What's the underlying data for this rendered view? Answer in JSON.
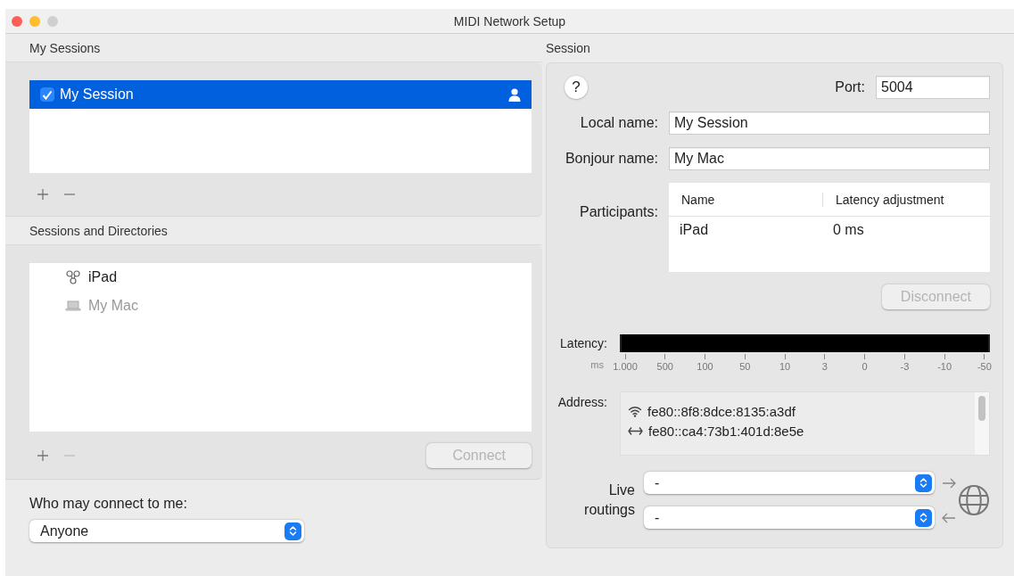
{
  "window": {
    "title": "MIDI Network Setup"
  },
  "my_sessions": {
    "heading": "My Sessions",
    "items": [
      {
        "label": "My Session",
        "checked": true,
        "selected": true
      }
    ],
    "remove_disabled": false
  },
  "directories": {
    "heading": "Sessions and Directories",
    "items": [
      {
        "label": "iPad",
        "kind": "device",
        "disabled": false
      },
      {
        "label": "My Mac",
        "kind": "computer",
        "disabled": true
      }
    ],
    "remove_disabled": true,
    "connect": {
      "label": "Connect",
      "disabled": true
    }
  },
  "access": {
    "label": "Who may connect to me:",
    "value": "Anyone"
  },
  "session": {
    "heading": "Session",
    "help": "?",
    "port_label": "Port:",
    "port": "5004",
    "local_name_label": "Local name:",
    "local_name": "My Session",
    "bonjour_label": "Bonjour name:",
    "bonjour_name": "My Mac",
    "participants_label": "Participants:",
    "participants": {
      "columns": [
        "Name",
        "Latency adjustment"
      ],
      "rows": [
        [
          "iPad",
          "0 ms"
        ]
      ]
    },
    "disconnect": {
      "label": "Disconnect",
      "disabled": true
    },
    "latency": {
      "label": "Latency:",
      "unit": "ms",
      "level": 1,
      "ticks": [
        "1.000",
        "500",
        "100",
        "50",
        "10",
        "3",
        "0",
        "-3",
        "-10",
        "-50"
      ]
    },
    "address_label": "Address:",
    "addresses": [
      {
        "kind": "wifi",
        "text": "fe80::8f8:8dce:8135:a3df"
      },
      {
        "kind": "ethernet",
        "text": "fe80::ca4:73b1:401d:8e5e"
      }
    ],
    "routings_label": "Live routings",
    "routings": [
      {
        "kind": "outgoing",
        "value": "-"
      },
      {
        "kind": "incoming",
        "value": "-"
      }
    ]
  }
}
